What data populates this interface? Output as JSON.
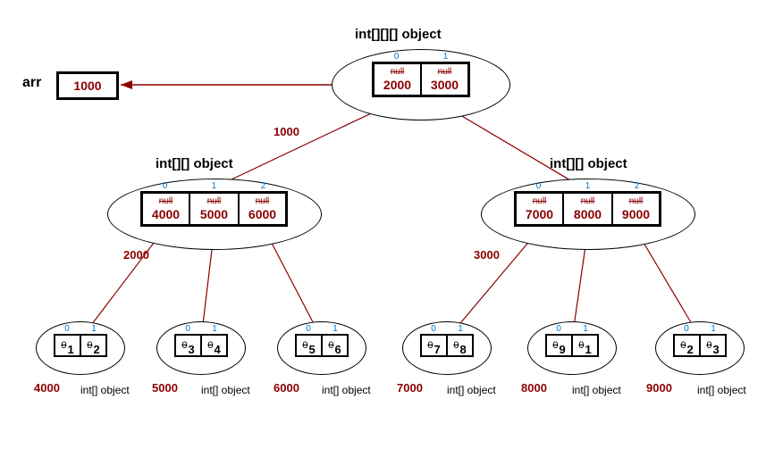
{
  "arr_label": "arr",
  "arr_value": "1000",
  "top": {
    "title": "int[][][] object",
    "indices": [
      "0",
      "1"
    ],
    "nulls": [
      "null",
      "null"
    ],
    "values": [
      "2000",
      "3000"
    ],
    "address": "1000"
  },
  "mid_left": {
    "title": "int[][] object",
    "indices": [
      "0",
      "1",
      "2"
    ],
    "nulls": [
      "null",
      "null",
      "null"
    ],
    "values": [
      "4000",
      "5000",
      "6000"
    ],
    "address": "2000"
  },
  "mid_right": {
    "title": "int[][] object",
    "indices": [
      "0",
      "1",
      "2"
    ],
    "nulls": [
      "null",
      "null",
      "null"
    ],
    "values": [
      "7000",
      "8000",
      "9000"
    ],
    "address": "3000"
  },
  "leaves": [
    {
      "addr": "4000",
      "lbl": "int[] object",
      "idx": [
        "0",
        "1"
      ],
      "zeros": [
        "0",
        "0"
      ],
      "subs": [
        "1",
        "2"
      ]
    },
    {
      "addr": "5000",
      "lbl": "int[] object",
      "idx": [
        "0",
        "1"
      ],
      "zeros": [
        "0",
        "0"
      ],
      "subs": [
        "3",
        "4"
      ]
    },
    {
      "addr": "6000",
      "lbl": "int[] object",
      "idx": [
        "0",
        "1"
      ],
      "zeros": [
        "0",
        "0"
      ],
      "subs": [
        "5",
        "6"
      ]
    },
    {
      "addr": "7000",
      "lbl": "int[] object",
      "idx": [
        "0",
        "1"
      ],
      "zeros": [
        "0",
        "0"
      ],
      "subs": [
        "7",
        "8"
      ]
    },
    {
      "addr": "8000",
      "lbl": "int[] object",
      "idx": [
        "0",
        "1"
      ],
      "zeros": [
        "0",
        "0"
      ],
      "subs": [
        "9",
        "1"
      ]
    },
    {
      "addr": "9000",
      "lbl": "int[] object",
      "idx": [
        "0",
        "1"
      ],
      "zeros": [
        "0",
        "0"
      ],
      "subs": [
        "2",
        "3"
      ]
    }
  ]
}
